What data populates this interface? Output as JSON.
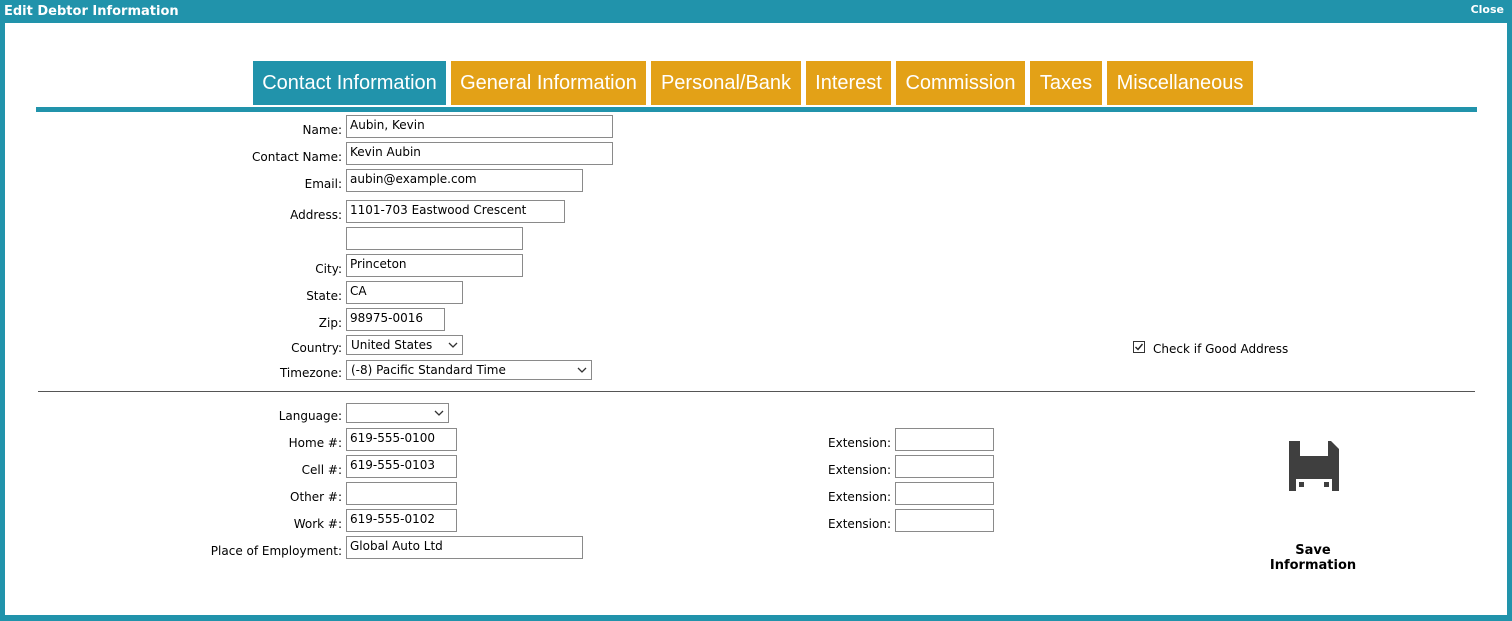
{
  "window": {
    "title": "Edit Debtor Information",
    "close_label": "Close"
  },
  "tabs": [
    {
      "label": "Contact Information",
      "active": true
    },
    {
      "label": "General Information",
      "active": false
    },
    {
      "label": "Personal/Bank",
      "active": false
    },
    {
      "label": "Interest",
      "active": false
    },
    {
      "label": "Commission",
      "active": false
    },
    {
      "label": "Taxes",
      "active": false
    },
    {
      "label": "Miscellaneous",
      "active": false
    }
  ],
  "colors": {
    "accent": "#2193ab",
    "tab_inactive": "#e3a117"
  },
  "contact": {
    "name_label": "Name:",
    "name_value": "Aubin, Kevin",
    "contact_name_label": "Contact Name:",
    "contact_name_value": "Kevin Aubin",
    "email_label": "Email:",
    "email_value": "aubin@example.com",
    "address_label": "Address:",
    "address1_value": "1101-703 Eastwood Crescent",
    "address2_value": "",
    "city_label": "City:",
    "city_value": "Princeton",
    "state_label": "State:",
    "state_value": "CA",
    "zip_label": "Zip:",
    "zip_value": "98975-0016",
    "country_label": "Country:",
    "country_value": "United States",
    "timezone_label": "Timezone:",
    "timezone_value": "(-8) Pacific Standard Time",
    "good_address_label": "Check if Good Address",
    "good_address_checked": true
  },
  "phones": {
    "language_label": "Language:",
    "language_value": "",
    "home_label": "Home #:",
    "home_value": "619-555-0100",
    "cell_label": "Cell #:",
    "cell_value": "619-555-0103",
    "other_label": "Other #:",
    "other_value": "",
    "work_label": "Work #:",
    "work_value": "619-555-0102",
    "employment_label": "Place of Employment:",
    "employment_value": "Global Auto Ltd",
    "extension_label": "Extension:",
    "home_ext": "",
    "cell_ext": "",
    "other_ext": "",
    "work_ext": ""
  },
  "save": {
    "label": "Save Information",
    "icon": "floppy-disk-icon"
  }
}
